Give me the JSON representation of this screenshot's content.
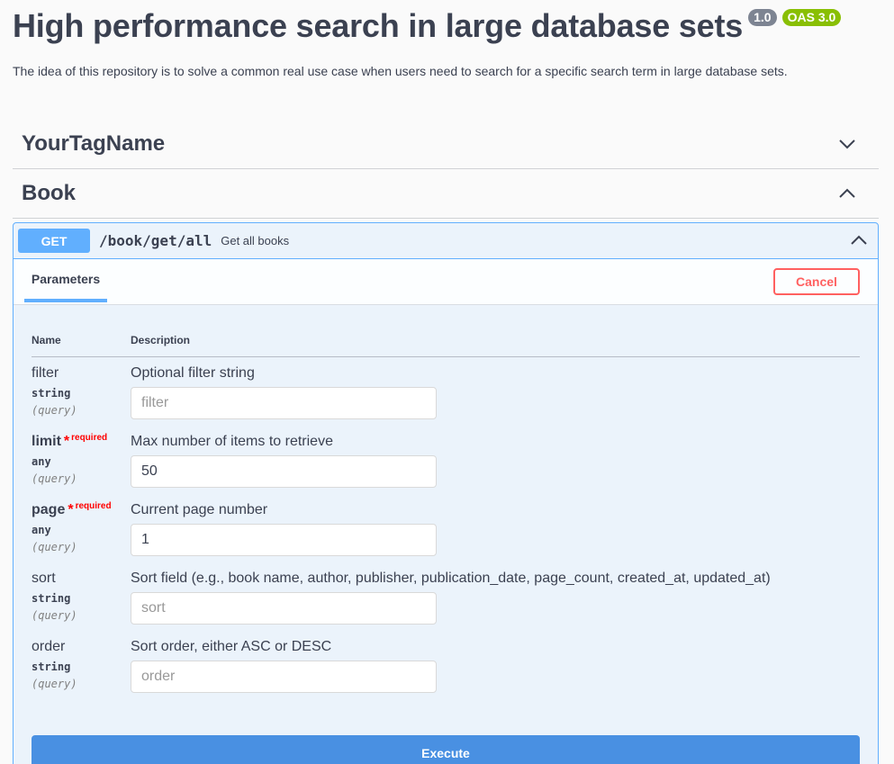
{
  "info": {
    "title": "High performance search in large database sets",
    "version_badge": "1.0",
    "oas_badge": "OAS 3.0",
    "description": "The idea of this repository is to solve a common real use case when users need to search for a specific search term in large database sets."
  },
  "tags": [
    {
      "name": "YourTagName",
      "expanded": false,
      "chevron_icon": "chevron-down-icon"
    },
    {
      "name": "Book",
      "expanded": true,
      "chevron_icon": "chevron-up-icon"
    }
  ],
  "operation": {
    "method": "GET",
    "path": "/book/get/all",
    "summary": "Get all books",
    "method_color": "#61affe"
  },
  "parameters_section": {
    "tab_label": "Parameters",
    "cancel_label": "Cancel",
    "col_name": "Name",
    "col_description": "Description",
    "required_label": "required",
    "required_star": "*",
    "execute_label": "Execute"
  },
  "params": [
    {
      "name": "filter",
      "type": "string",
      "in": "(query)",
      "required": false,
      "description": "Optional filter string",
      "value": "",
      "placeholder": "filter"
    },
    {
      "name": "limit",
      "type": "any",
      "in": "(query)",
      "required": true,
      "description": "Max number of items to retrieve",
      "value": "50",
      "placeholder": ""
    },
    {
      "name": "page",
      "type": "any",
      "in": "(query)",
      "required": true,
      "description": "Current page number",
      "value": "1",
      "placeholder": ""
    },
    {
      "name": "sort",
      "type": "string",
      "in": "(query)",
      "required": false,
      "description": "Sort field (e.g., book name, author, publisher, publication_date, page_count, created_at, updated_at)",
      "value": "",
      "placeholder": "sort"
    },
    {
      "name": "order",
      "type": "string",
      "in": "(query)",
      "required": false,
      "description": "Sort order, either ASC or DESC",
      "value": "",
      "placeholder": "order"
    }
  ],
  "colors": {
    "accent_blue": "#61affe",
    "execute_blue": "#4990e2",
    "cancel_red": "#ff6060",
    "required_red": "#ff0000",
    "version_badge_gray": "#7d8492",
    "oas_badge_green": "#89bf04"
  }
}
